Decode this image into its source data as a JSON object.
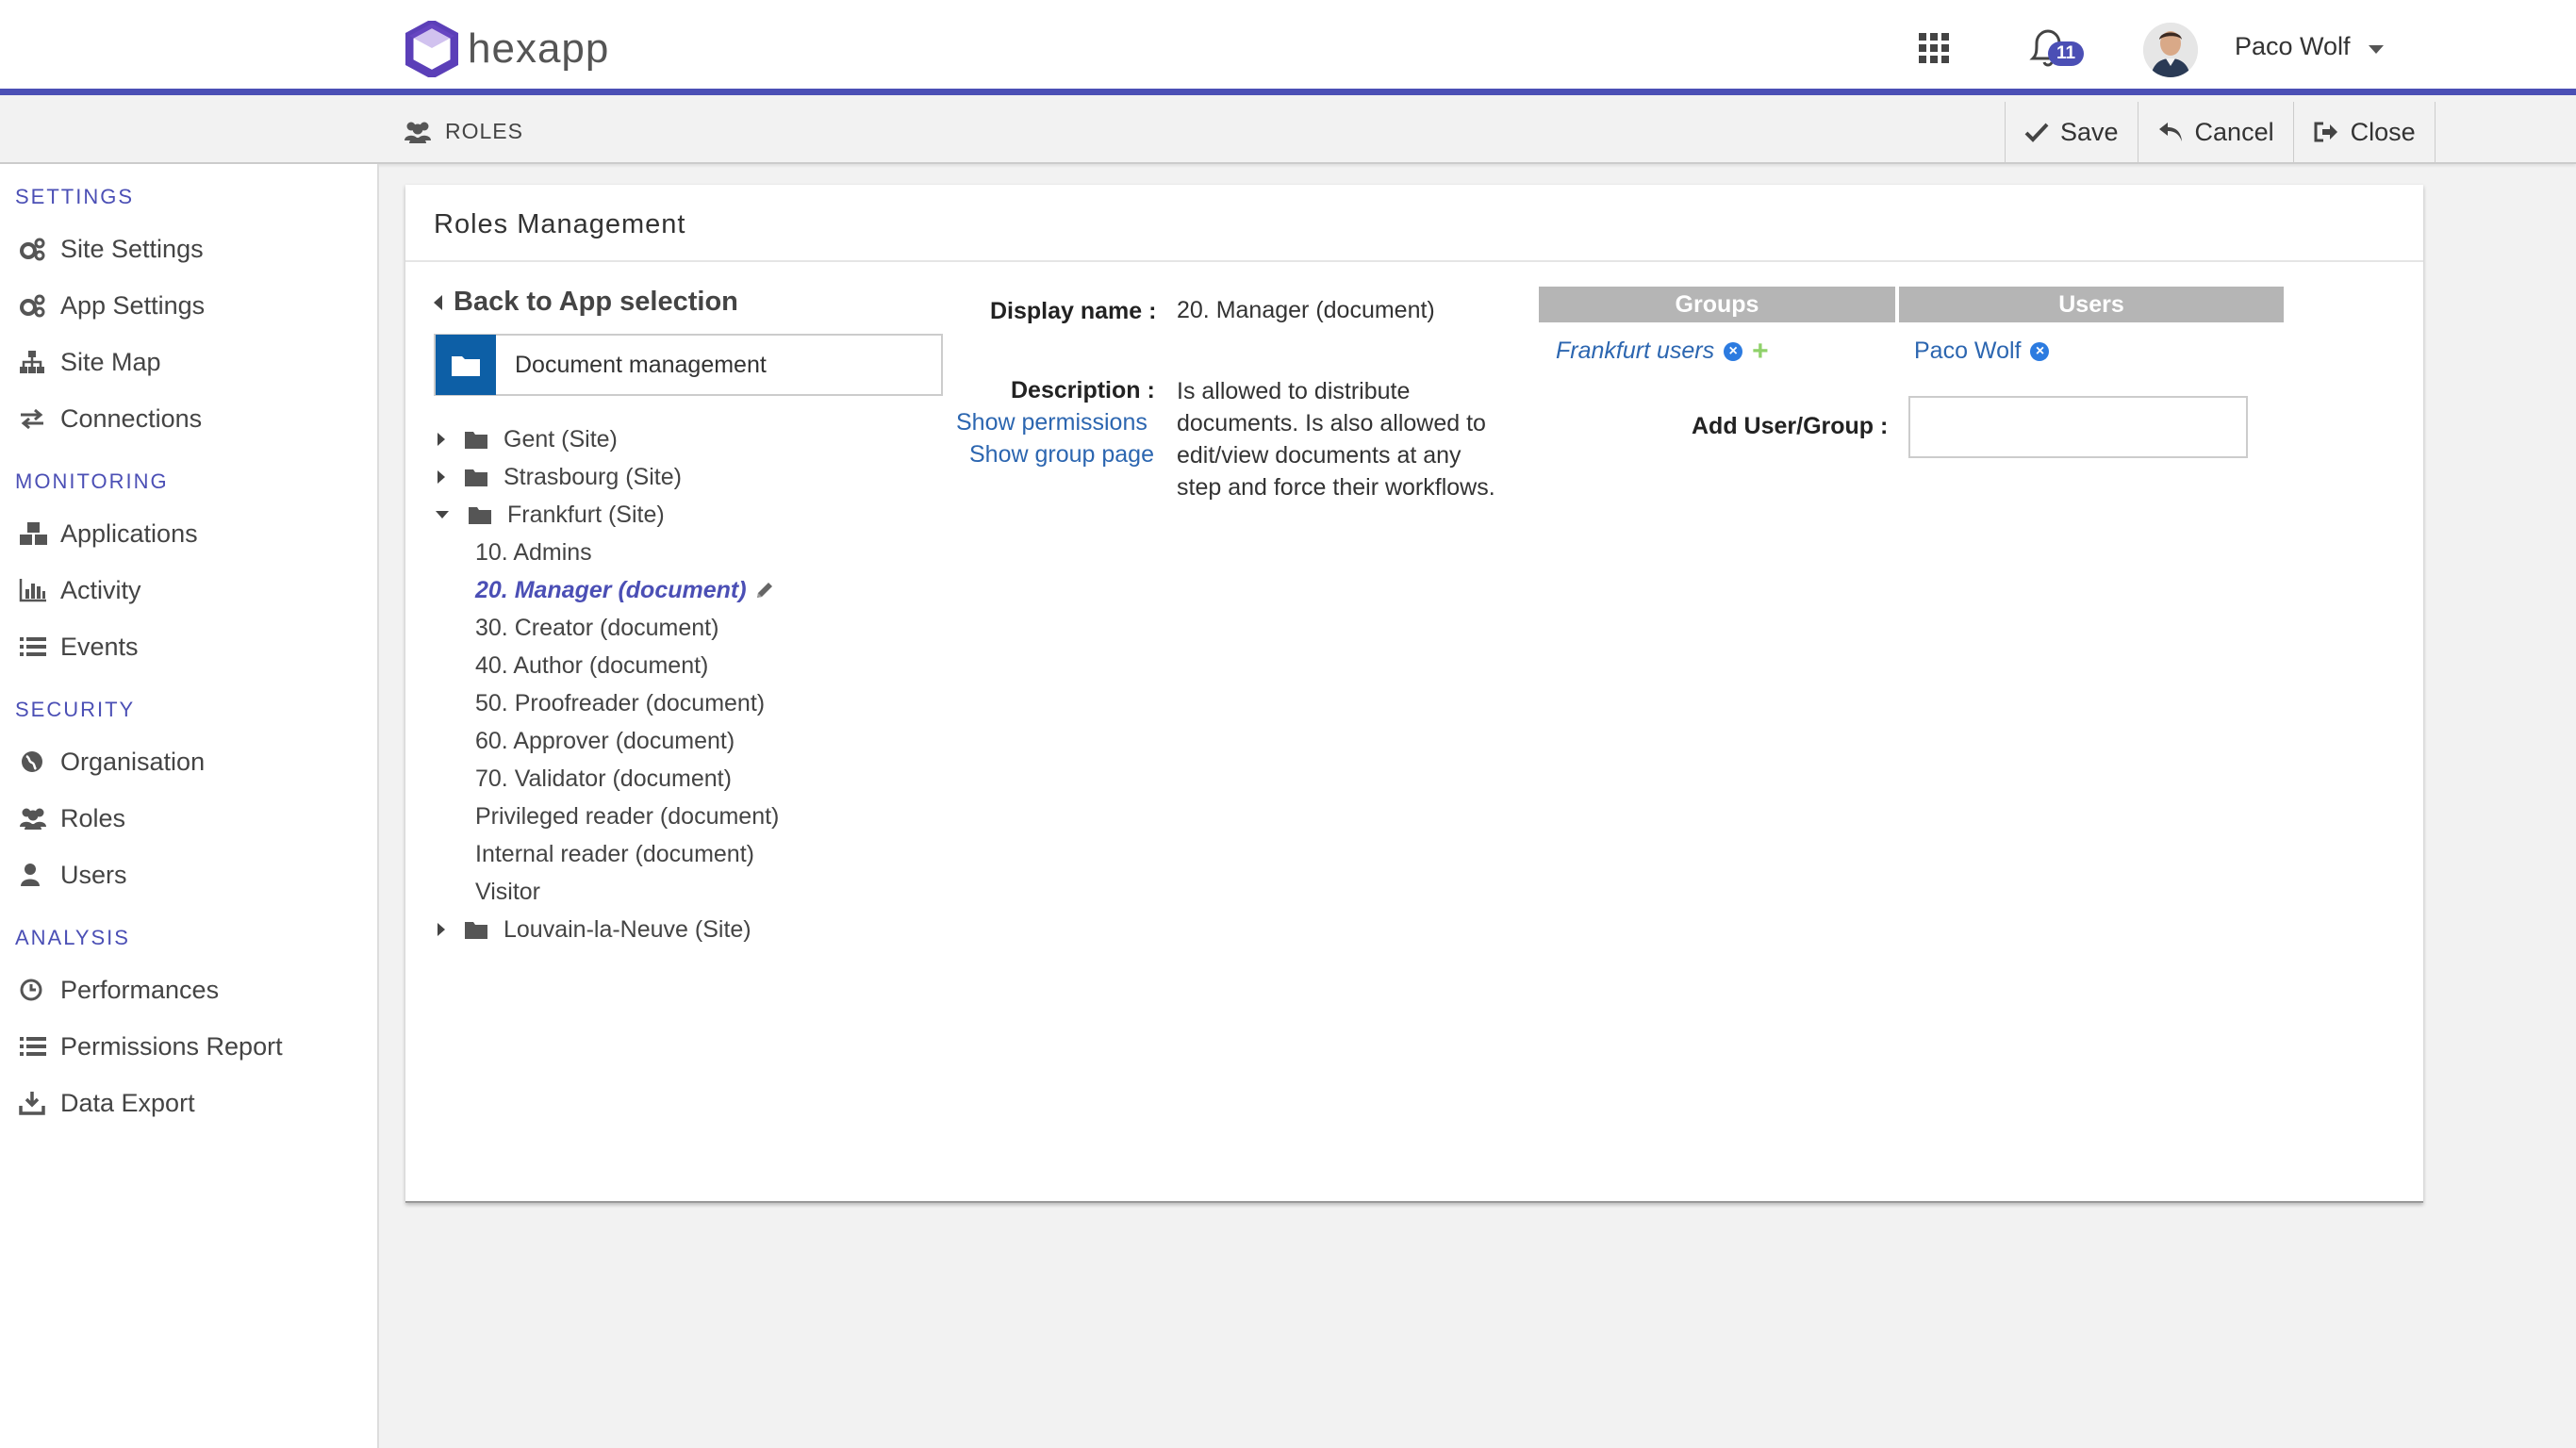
{
  "header": {
    "brand": "hexapp",
    "notification_count": "11",
    "user_name": "Paco Wolf",
    "accent_color": "#4b4fb5"
  },
  "subbar": {
    "title": "ROLES",
    "save_label": "Save",
    "cancel_label": "Cancel",
    "close_label": "Close"
  },
  "sidebar": {
    "sections": [
      {
        "title": "SETTINGS",
        "items": [
          {
            "label": "Site Settings",
            "icon": "cogs-icon"
          },
          {
            "label": "App Settings",
            "icon": "cogs-icon"
          },
          {
            "label": "Site Map",
            "icon": "sitemap-icon"
          },
          {
            "label": "Connections",
            "icon": "exchange-icon"
          }
        ]
      },
      {
        "title": "MONITORING",
        "items": [
          {
            "label": "Applications",
            "icon": "cubes-icon"
          },
          {
            "label": "Activity",
            "icon": "bar-chart-icon"
          },
          {
            "label": "Events",
            "icon": "list-icon"
          }
        ]
      },
      {
        "title": "SECURITY",
        "items": [
          {
            "label": "Organisation",
            "icon": "globe-icon"
          },
          {
            "label": "Roles",
            "icon": "users-icon"
          },
          {
            "label": "Users",
            "icon": "user-icon"
          }
        ]
      },
      {
        "title": "ANALYSIS",
        "items": [
          {
            "label": "Performances",
            "icon": "clock-icon"
          },
          {
            "label": "Permissions Report",
            "icon": "list-icon"
          },
          {
            "label": "Data Export",
            "icon": "download-icon"
          }
        ]
      }
    ]
  },
  "panel": {
    "title": "Roles Management",
    "back_label": "Back to App selection",
    "app_name": "Document management",
    "tree": {
      "sites": [
        "Gent (Site)",
        "Strasbourg (Site)",
        "Frankfurt (Site)",
        "Louvain-la-Neuve (Site)"
      ],
      "frankfurt_roles": [
        "10. Admins",
        "20. Manager (document)",
        "30. Creator (document)",
        "40. Author (document)",
        "50. Proofreader (document)",
        "60. Approver (document)",
        "70. Validator (document)",
        "Privileged reader (document)",
        "Internal reader (document)",
        "Visitor"
      ]
    },
    "detail": {
      "display_name_label": "Display name :",
      "display_name_value": "20. Manager (document)",
      "description_label": "Description :",
      "description_lines": [
        "Is allowed to distribute",
        "documents. Is also allowed to",
        "edit/view documents at any",
        "step and force their workflows."
      ],
      "show_permissions": "Show permissions",
      "show_group_page": "Show group page"
    },
    "members": {
      "groups_header": "Groups",
      "users_header": "Users",
      "group_item": "Frankfurt users",
      "user_item": "Paco Wolf",
      "add_label": "Add User/Group :",
      "add_value": ""
    }
  }
}
